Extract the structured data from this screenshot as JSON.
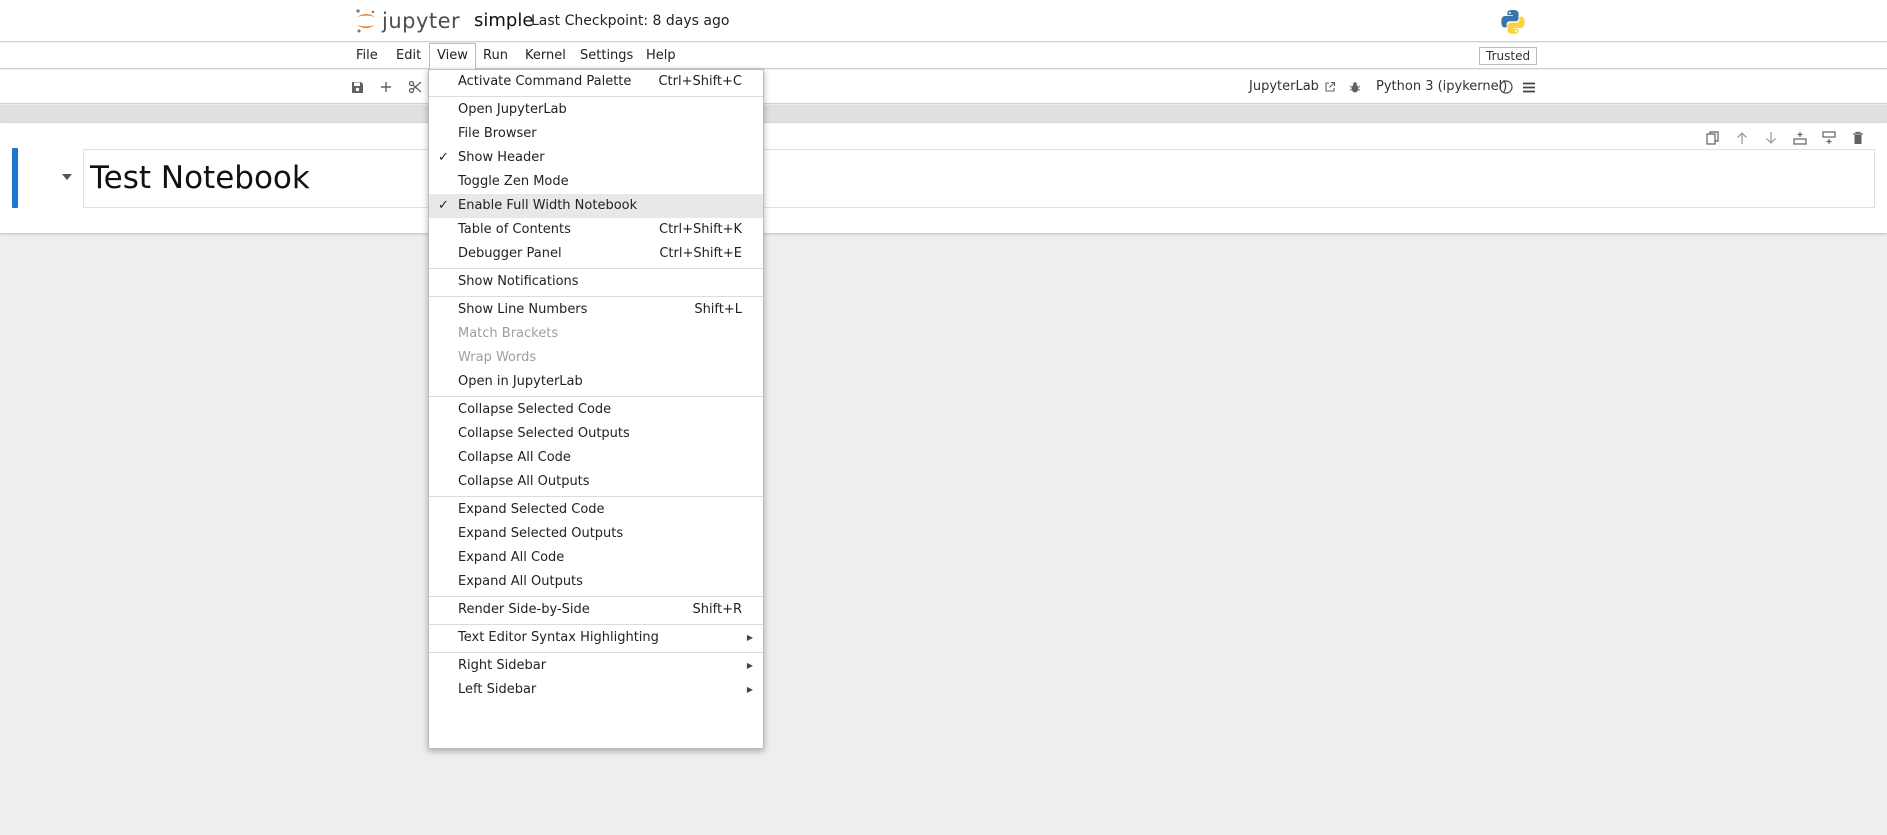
{
  "header": {
    "logo_text": "jupyter",
    "notebook_title": "simple",
    "checkpoint": "Last Checkpoint: 8 days ago",
    "trusted": "Trusted"
  },
  "menubar": [
    "File",
    "Edit",
    "View",
    "Run",
    "Kernel",
    "Settings",
    "Help"
  ],
  "active_menu": "View",
  "toolbar": {
    "jupyterlab_link": "JupyterLab",
    "kernel_name": "Python 3 (ipykernel)"
  },
  "cell": {
    "heading": "Test Notebook"
  },
  "view_menu": {
    "groups": [
      [
        {
          "label": "Activate Command Palette",
          "shortcut": "Ctrl+Shift+C"
        }
      ],
      [
        {
          "label": "Open JupyterLab"
        },
        {
          "label": "File Browser"
        },
        {
          "label": "Show Header",
          "checked": true
        },
        {
          "label": "Toggle Zen Mode"
        },
        {
          "label": "Enable Full Width Notebook",
          "checked": true,
          "highlighted": true
        },
        {
          "label": "Table of Contents",
          "shortcut": "Ctrl+Shift+K"
        },
        {
          "label": "Debugger Panel",
          "shortcut": "Ctrl+Shift+E"
        }
      ],
      [
        {
          "label": "Show Notifications"
        }
      ],
      [
        {
          "label": "Show Line Numbers",
          "shortcut": "Shift+L"
        },
        {
          "label": "Match Brackets",
          "disabled": true
        },
        {
          "label": "Wrap Words",
          "disabled": true
        },
        {
          "label": "Open in JupyterLab"
        }
      ],
      [
        {
          "label": "Collapse Selected Code"
        },
        {
          "label": "Collapse Selected Outputs"
        },
        {
          "label": "Collapse All Code"
        },
        {
          "label": "Collapse All Outputs"
        }
      ],
      [
        {
          "label": "Expand Selected Code"
        },
        {
          "label": "Expand Selected Outputs"
        },
        {
          "label": "Expand All Code"
        },
        {
          "label": "Expand All Outputs"
        }
      ],
      [
        {
          "label": "Render Side-by-Side",
          "shortcut": "Shift+R"
        }
      ],
      [
        {
          "label": "Text Editor Syntax Highlighting",
          "submenu": true
        }
      ],
      [
        {
          "label": "Right Sidebar",
          "submenu": true
        },
        {
          "label": "Left Sidebar",
          "submenu": true
        }
      ]
    ]
  },
  "colors": {
    "accent": "#1976d2",
    "jupyter_orange": "#f37726"
  }
}
